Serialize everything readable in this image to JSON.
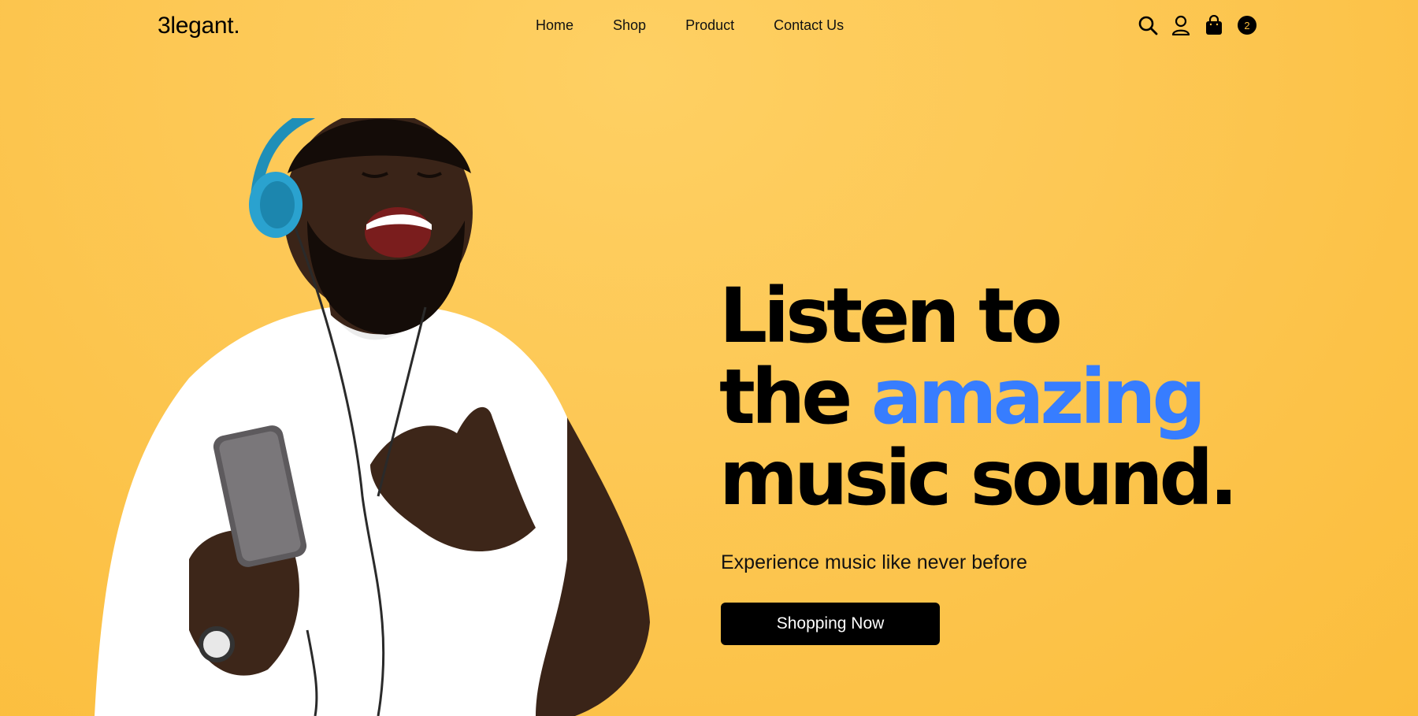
{
  "brand": {
    "logo": "3legant."
  },
  "nav": {
    "items": [
      {
        "label": "Home"
      },
      {
        "label": "Shop"
      },
      {
        "label": "Product"
      },
      {
        "label": "Contact Us"
      }
    ]
  },
  "header_icons": {
    "search": "search-icon",
    "account": "user-icon",
    "cart": "shopping-bag-icon",
    "cart_count": "2"
  },
  "hero": {
    "headline_line1": "Listen to",
    "headline_line2_plain": "the ",
    "headline_line2_accent": "amazing",
    "headline_line3": "music sound.",
    "subtitle": "Experience music like never before",
    "cta_label": "Shopping Now",
    "accent_color": "#377dff",
    "background_color": "#fdc855"
  }
}
